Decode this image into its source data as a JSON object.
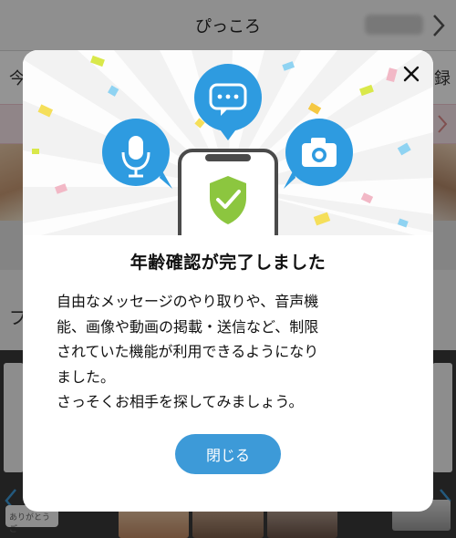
{
  "app": {
    "header_title": "ぴっころ",
    "tab_left_partial": "今",
    "tab_right_partial": "録",
    "section_letter_partial": "プ",
    "bubble_text_partial": "ありがとうご"
  },
  "modal": {
    "title": "年齢確認が完了しました",
    "body_lines": [
      "自由なメッセージのやり取りや、音声機",
      "能、画像や動画の掲載・送信など、制限",
      "されていた機能が利用できるようになり",
      "ました。",
      "さっそくお相手を探してみましょう。"
    ],
    "close_button_label": "閉じる",
    "close_icon": "close-icon",
    "hero_icons": [
      "microphone-icon",
      "chat-bubble-icon",
      "camera-icon",
      "smartphone-icon",
      "shield-check-icon"
    ]
  },
  "colors": {
    "accent_blue": "#3d9ad8",
    "icon_blue": "#2e9be0",
    "shield_green": "#8cc63f",
    "overlay": "rgba(0,0,0,0.42)"
  }
}
